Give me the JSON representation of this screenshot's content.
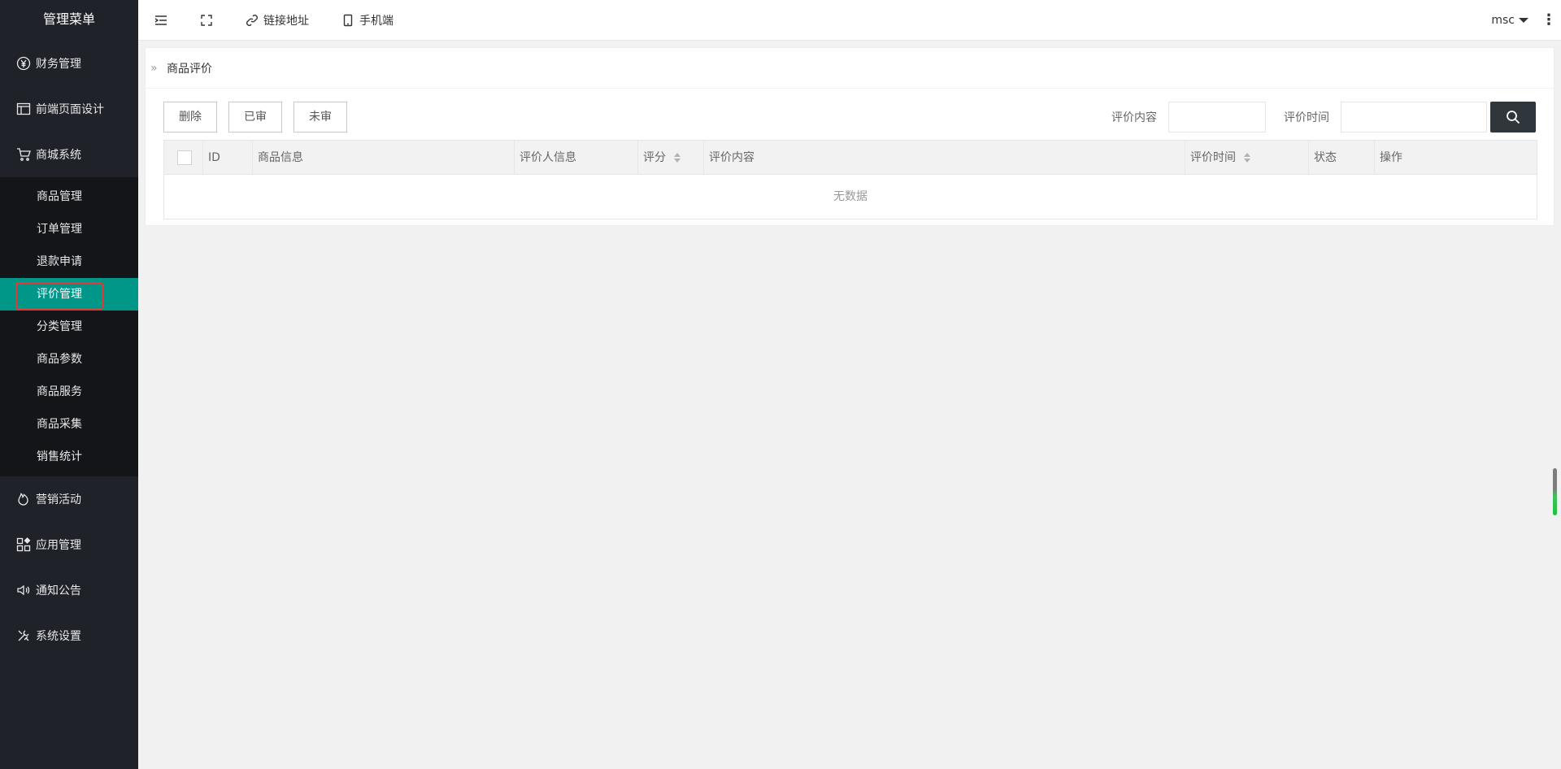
{
  "sidebar": {
    "title": "管理菜单",
    "top_items": [
      {
        "label": "财务管理",
        "icon": "yen-circle-icon"
      },
      {
        "label": "前端页面设计",
        "icon": "layout-icon"
      },
      {
        "label": "商城系统",
        "icon": "cart-icon"
      }
    ],
    "sub_items": [
      {
        "label": "商品管理"
      },
      {
        "label": "订单管理"
      },
      {
        "label": "退款申请"
      },
      {
        "label": "评价管理",
        "active": true
      },
      {
        "label": "分类管理"
      },
      {
        "label": "商品参数"
      },
      {
        "label": "商品服务"
      },
      {
        "label": "商品采集"
      },
      {
        "label": "销售统计"
      }
    ],
    "bottom_items": [
      {
        "label": "营销活动",
        "icon": "fire-icon"
      },
      {
        "label": "应用管理",
        "icon": "apps-icon"
      },
      {
        "label": "通知公告",
        "icon": "speaker-icon"
      },
      {
        "label": "系统设置",
        "icon": "tools-icon"
      }
    ]
  },
  "header": {
    "link_label": "链接地址",
    "mobile_label": "手机端",
    "user": "msc",
    "more": "⋮"
  },
  "breadcrumb": {
    "arrow": "»",
    "title": "商品评价"
  },
  "toolbar": {
    "delete_label": "删除",
    "approved_label": "已审",
    "unapproved_label": "未审",
    "content_label": "评价内容",
    "content_value": "",
    "time_label": "评价时间",
    "time_value": ""
  },
  "table": {
    "columns": [
      "ID",
      "商品信息",
      "评价人信息",
      "评分",
      "评价内容",
      "评价时间",
      "状态",
      "操作"
    ],
    "empty_text": "无数据"
  },
  "colors": {
    "sidebar_bg": "#20222a",
    "submenu_bg": "#141519",
    "active_bg": "#009688",
    "highlight_border": "#e53935",
    "search_btn": "#2f363c"
  }
}
